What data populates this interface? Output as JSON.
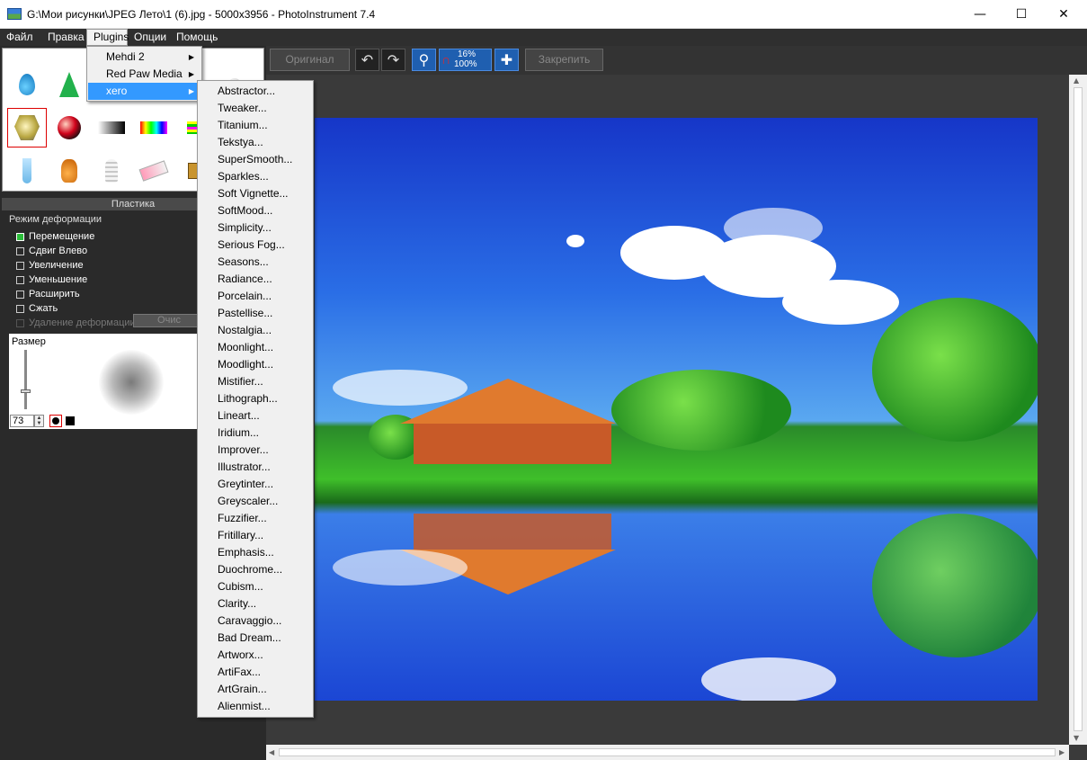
{
  "window": {
    "title": "G:\\Мои рисунки\\JPEG Лето\\1 (6).jpg - 5000x3956 - PhotoInstrument 7.4",
    "minimize_icon": "minimize-icon",
    "maximize_icon": "maximize-icon",
    "close_icon": "close-icon"
  },
  "menubar": {
    "items": [
      "Файл",
      "Правка",
      "Plugins",
      "Опции",
      "Помощь"
    ],
    "active": "Plugins"
  },
  "toolbar": {
    "original_label": "Оригинал",
    "lock_label": "Закрепить",
    "zoom_current": "16%",
    "zoom_full": "100%"
  },
  "plugins_menu": {
    "items": [
      {
        "label": "Mehdi 2",
        "has_submenu": true
      },
      {
        "label": "Red Paw Media",
        "has_submenu": true
      },
      {
        "label": "xero",
        "has_submenu": true,
        "highlighted": true
      }
    ]
  },
  "xero_submenu": {
    "items": [
      "Abstractor...",
      "Tweaker...",
      "Titanium...",
      "Tekstya...",
      "SuperSmooth...",
      "Sparkles...",
      "Soft Vignette...",
      "SoftMood...",
      "Simplicity...",
      "Serious Fog...",
      "Seasons...",
      "Radiance...",
      "Porcelain...",
      "Pastellise...",
      "Nostalgia...",
      "Moonlight...",
      "Moodlight...",
      "Mistifier...",
      "Lithograph...",
      "Lineart...",
      "Iridium...",
      "Improver...",
      "Illustrator...",
      "Greytinter...",
      "Greyscaler...",
      "Fuzzifier...",
      "Fritillary...",
      "Emphasis...",
      "Duochrome...",
      "Cubism...",
      "Clarity...",
      "Caravaggio...",
      "Bad Dream...",
      "Artworx...",
      "ArtiFax...",
      "ArtGrain...",
      "Alienmist..."
    ]
  },
  "left_panel": {
    "section_title": "Пластика",
    "deform_mode_label": "Режим деформации",
    "modes": [
      {
        "label": "Перемещение",
        "checked": true
      },
      {
        "label": "Сдвиг Влево",
        "checked": false
      },
      {
        "label": "Увеличение",
        "checked": false
      },
      {
        "label": "Уменьшение",
        "checked": false
      },
      {
        "label": "Расширить",
        "checked": false
      },
      {
        "label": "Сжать",
        "checked": false
      },
      {
        "label": "Удаление деформации",
        "checked": false,
        "disabled": true
      }
    ],
    "clear_label": "Очис",
    "size_label": "Размер",
    "size_value": "73"
  }
}
